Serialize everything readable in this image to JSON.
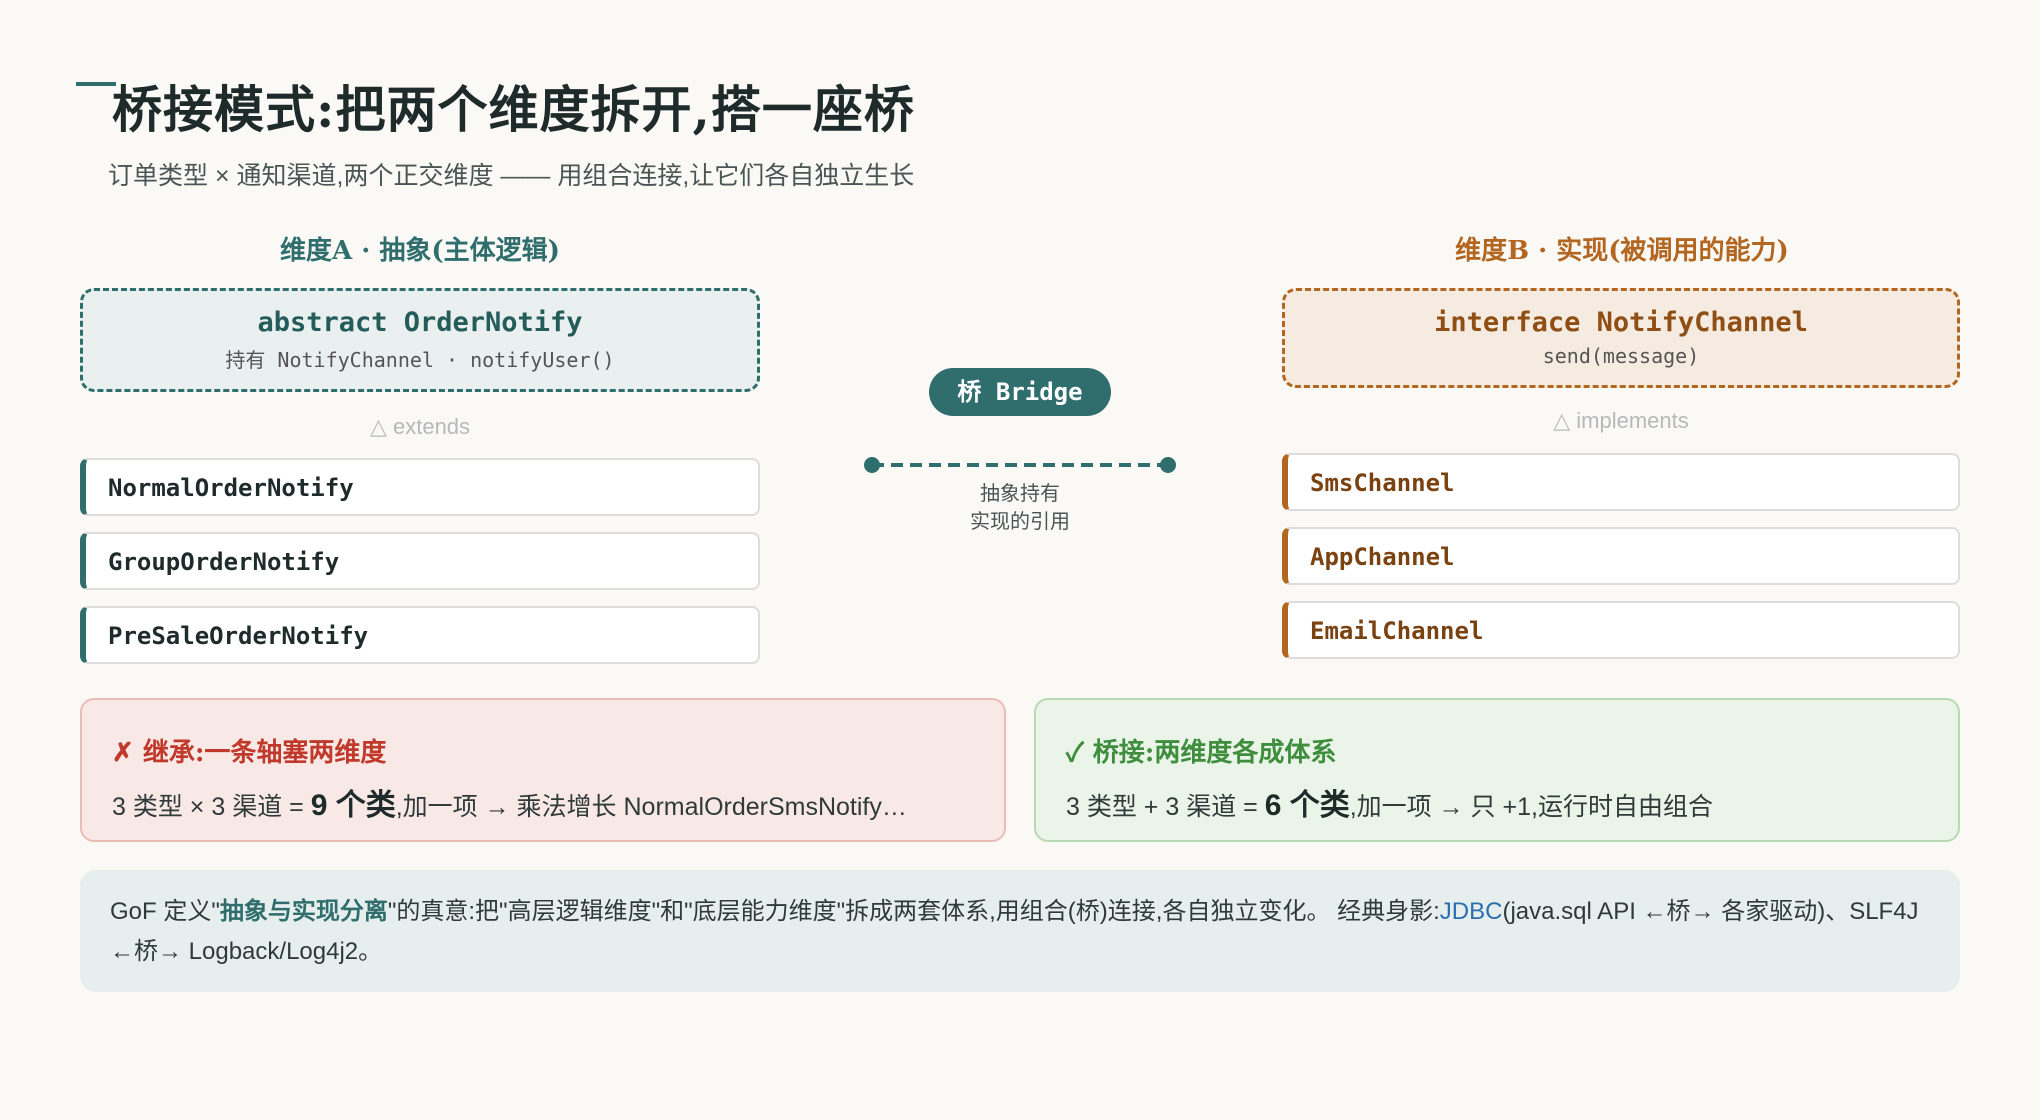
{
  "header": {
    "title": "桥接模式:把两个维度拆开,搭一座桥",
    "subtitle": "订单类型 × 通知渠道,两个正交维度 —— 用组合连接,让它们各自独立生长"
  },
  "dimension_a": {
    "title": "维度A · 抽象(主体逻辑)",
    "root_name": "abstract OrderNotify",
    "root_sub": "持有 NotifyChannel · notifyUser()",
    "relation_label": "△ extends",
    "items": [
      "NormalOrderNotify",
      "GroupOrderNotify",
      "PreSaleOrderNotify"
    ]
  },
  "dimension_b": {
    "title": "维度B · 实现(被调用的能力)",
    "root_name": "interface NotifyChannel",
    "root_sub": "send(message)",
    "relation_label": "△ implements",
    "items": [
      "SmsChannel",
      "AppChannel",
      "EmailChannel"
    ]
  },
  "bridge": {
    "label": "桥 Bridge",
    "caption_line1": "抽象持有",
    "caption_line2": "实现的引用"
  },
  "inherit_panel": {
    "title": "✗ 继承:一条轴塞两维度",
    "body_prefix": "3 类型 × 3 渠道 = ",
    "body_big": "9 个类",
    "body_suffix": ",加一项 → 乘法增长 NormalOrderSmsNotify…"
  },
  "bridge_panel": {
    "title": "✓ 桥接:两维度各成体系",
    "body_prefix": "3 类型 + 3 渠道 = ",
    "body_big": "6 个类",
    "body_suffix": ",加一项 → 只 +1,运行时自由组合"
  },
  "note": {
    "part1": "GoF 定义\"",
    "highlight": "抽象与实现分离",
    "part2": "\"的真意:把\"高层逻辑维度\"和\"底层能力维度\"拆成两套体系,用组合(桥)连接,各自独立变化。  经典身影:",
    "jdbc": "JDBC",
    "part3": "(java.sql API ←桥→ 各家驱动)、SLF4J ←桥→ Logback/Log4j2。"
  },
  "colors": {
    "teal": "#2f6e6c",
    "orange": "#b2661f",
    "red": "#c0392b",
    "green": "#3e8e3e"
  }
}
